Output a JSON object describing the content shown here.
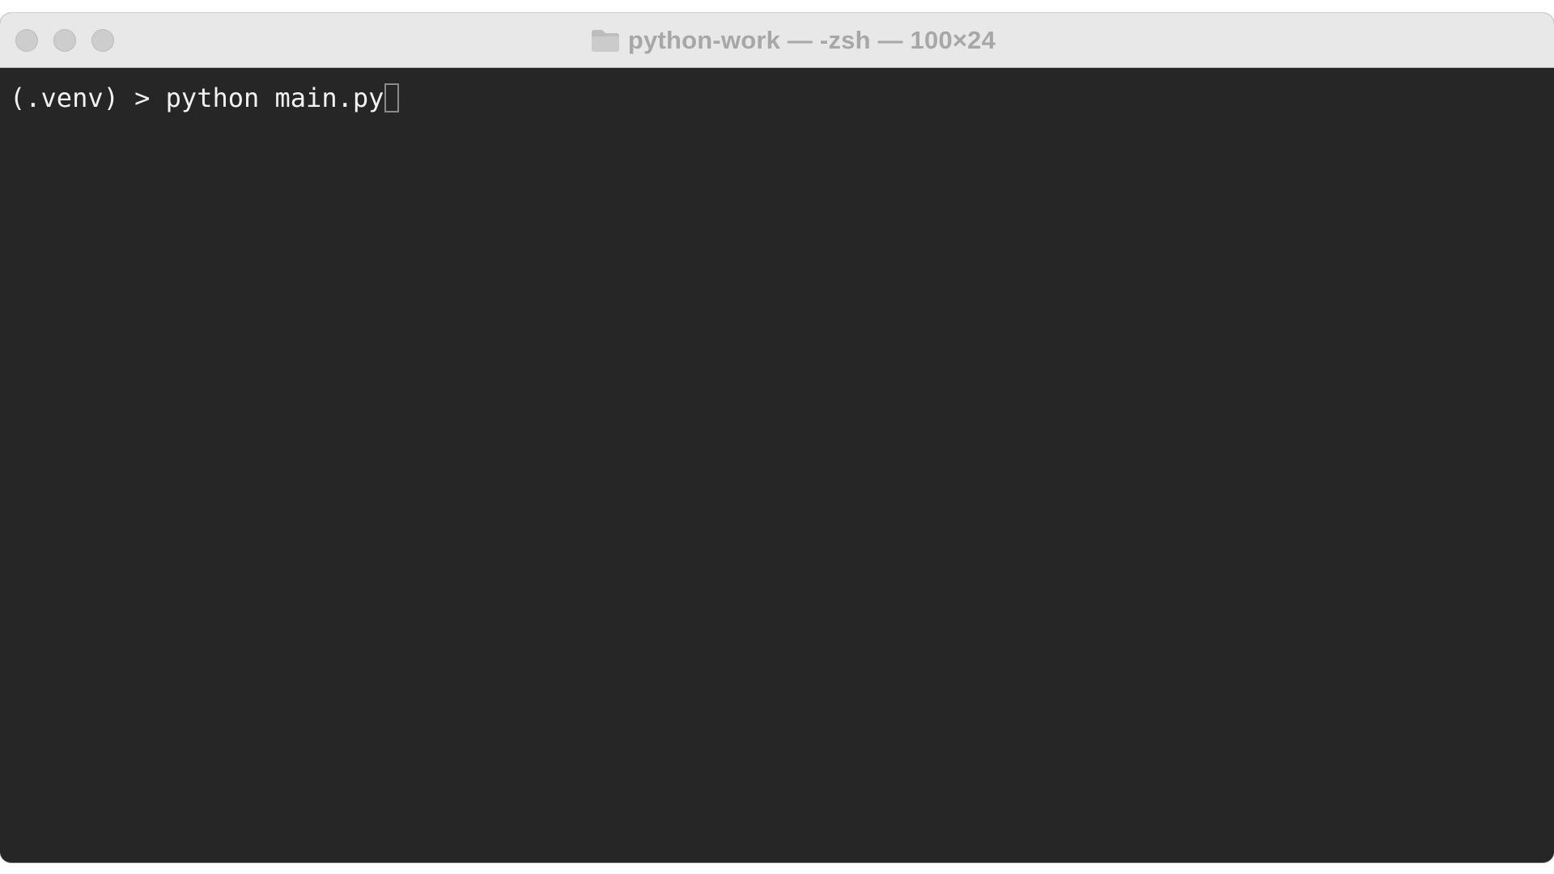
{
  "window": {
    "title": "python-work — -zsh — 100×24"
  },
  "traffic_lights": {
    "close": "close-button",
    "minimize": "minimize-button",
    "zoom": "zoom-button",
    "color": "#cdcdcd"
  },
  "terminal": {
    "background": "#262626",
    "foreground": "#f2f2f2",
    "prompt": "(.venv) > ",
    "command": "python main.py"
  },
  "icons": {
    "title": "folder-icon"
  }
}
